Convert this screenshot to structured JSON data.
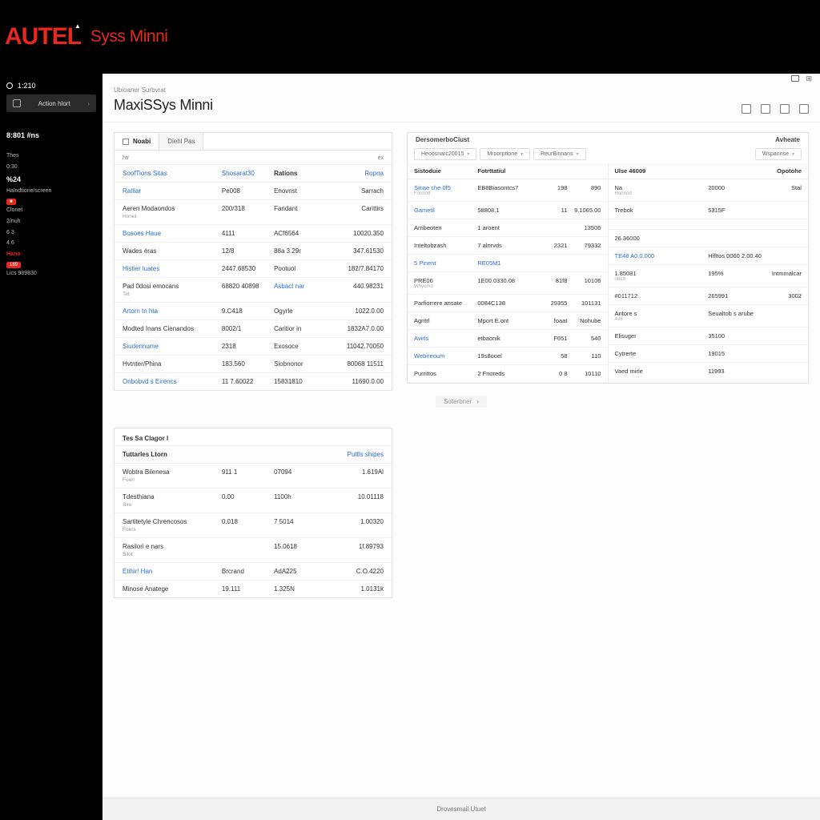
{
  "brand": {
    "logo": "AUTEL",
    "sub": "Syss Minni"
  },
  "sidebar": {
    "status": "1:210",
    "action_btn": "Action  hlort",
    "section": "8:801 #ns",
    "items": [
      {
        "label": "Thes",
        "cls": ""
      },
      {
        "label": "0:30",
        "cls": ""
      },
      {
        "label": "%24",
        "cls": "bright"
      },
      {
        "label": "Halndtione/screen",
        "cls": ""
      },
      {
        "label": "",
        "cls": "badge"
      },
      {
        "label": "Clonet",
        "cls": ""
      },
      {
        "label": "2/nuh",
        "cls": ""
      },
      {
        "label": "6 3",
        "cls": ""
      },
      {
        "label": "4.6",
        "cls": ""
      },
      {
        "label": "Hano",
        "cls": "accent"
      },
      {
        "label": "189",
        "cls": "badge"
      },
      {
        "label": "Lics  989830",
        "cls": ""
      }
    ]
  },
  "header": {
    "crumb": "Ubioaner  Surbvrat",
    "title": "MaxiSSys  Minni"
  },
  "panel1": {
    "tabs": [
      "Noabi",
      "Diehl Pas"
    ],
    "sub_left": "htr",
    "sub_right": "ex",
    "cols": [
      "SoofTions Sitas",
      "Shosarat30",
      "Rations",
      "Ropna"
    ],
    "rows": [
      {
        "a": "Ratiiar",
        "sub": "",
        "b": "Pe008",
        "c": "Enovnst",
        "d": "Sarrach"
      },
      {
        "a": "Aeren Modaondos",
        "sub": "Honet",
        "b": "200/318",
        "c": "Fandant",
        "d": "Carittirs"
      },
      {
        "a": "Bosoes Haue",
        "sub": "",
        "b": "4111",
        "c": "ACf6564",
        "d": "10020.350"
      },
      {
        "a": "Wades éras",
        "sub": "",
        "b": "12/8",
        "c": "88a 3.29r",
        "d": "347.61530"
      },
      {
        "a": "Histier luates",
        "sub": "",
        "b": "2447.68530",
        "c": "Pootuol",
        "d": "182/7.84170"
      },
      {
        "a": "Pad 0dosi emocans",
        "sub": "Tet",
        "b": "68820 40898",
        "c": "Asbact nar",
        "d": "440.98231"
      },
      {
        "a": "Artorn tn hta",
        "sub": "",
        "b": "9.C418",
        "c": "Ogyrle",
        "d": "1022.0.00"
      },
      {
        "a": "Modted Inans Cienandos",
        "sub": "",
        "b": "8002/1",
        "c": "Caritior in",
        "d": "1832A7.0.00"
      },
      {
        "a": "Siudennume",
        "sub": "",
        "b": "2318",
        "c": "Exosoce",
        "d": "11042.70050"
      },
      {
        "a": "Hvtnter/Phina",
        "sub": "",
        "b": "183.560",
        "c": "Siobnonor",
        "d": "80068 11511"
      },
      {
        "a": "Onbobvd s Eirencs",
        "sub": "",
        "b": "11 7.60022",
        "c": "15831810",
        "d": "11690.0.00"
      }
    ]
  },
  "pager": "Soterbner",
  "panel2": {
    "top_left": "DersomerboCiust",
    "top_right": "Avheate",
    "filters": [
      "Heoosnarc20015",
      "Mroorpttone",
      "ReurBinnans",
      "Wspannse"
    ],
    "left": {
      "head": [
        "Sistoduie",
        "Fotrttatiul",
        "",
        ""
      ],
      "rows": [
        {
          "a": "Sinae che 0f5",
          "sub": "Fonnod",
          "b": "EB8Biasontcs7",
          "c": "198",
          "d": "890"
        },
        {
          "a": "Gametil",
          "sub": "",
          "b": "58808.1",
          "c": "11",
          "d": "9.1065.00"
        },
        {
          "a": "Arribeoten",
          "sub": "",
          "b": "1 aroent",
          "c": "",
          "d": "13506"
        },
        {
          "a": "Inteltobzash",
          "sub": "",
          "b": "7 alnrvds",
          "c": "2321",
          "d": "79332"
        },
        {
          "a": "5 Pinent",
          "sub": "",
          "b": "RE05M1",
          "c": "",
          "d": ""
        },
        {
          "a": "PRE06",
          "sub": "Whyomd",
          "b": "1E00.0330.08",
          "c": "81f8",
          "d": "10106"
        },
        {
          "a": "Parfiorrere ansate",
          "sub": "",
          "b": "0084C138",
          "c": "29355",
          "d": "101131"
        },
        {
          "a": "Agritrl",
          "sub": "",
          "b": "Mport E.ont",
          "c": "foaat",
          "d": "Nohube"
        },
        {
          "a": "Avirls",
          "sub": "",
          "b": "etbaonik",
          "c": "F651",
          "d": "540"
        },
        {
          "a": "Webireoum",
          "sub": "",
          "b": "19s8ooel",
          "c": "58",
          "d": "110"
        },
        {
          "a": "Purrittos",
          "sub": "",
          "b": "2 Fnoreds",
          "c": "0 8",
          "d": "10110"
        }
      ]
    },
    "right": {
      "head": [
        "Ulse 46009",
        "Opotohe"
      ],
      "rows": [
        {
          "a": "Na",
          "sub": "Hormod",
          "b": "20000",
          "c": "Stal"
        },
        {
          "a": "Trebok",
          "sub": "",
          "b": "5315F",
          "c": ""
        },
        {
          "a": "",
          "sub": "",
          "b": "",
          "c": ""
        },
        {
          "a": "26.36000",
          "sub": "",
          "b": "",
          "c": ""
        },
        {
          "a": "TE48 A0.0.000",
          "sub": "",
          "b": "Hifltos 0060 2.00.40",
          "c": ""
        },
        {
          "a": "1.85081",
          "sub": "0819",
          "b": "195%",
          "c": "Intmmalcar"
        },
        {
          "a": "#011712",
          "sub": "",
          "b": "265991",
          "c": "3002"
        },
        {
          "a": "Antore s",
          "sub": "Aint",
          "b": "Seualtob s arube",
          "c": ""
        },
        {
          "a": "Elisuger",
          "sub": "",
          "b": "35100",
          "c": ""
        },
        {
          "a": "Cytrerte",
          "sub": "",
          "b": "19015",
          "c": ""
        },
        {
          "a": "Vaed mirle",
          "sub": "",
          "b": "11993",
          "c": ""
        }
      ]
    }
  },
  "panel3": {
    "title": "Tes Sa Clagor l",
    "cols": [
      "Tuttarles Ltorn",
      "",
      "",
      "Puttls shipes"
    ],
    "rows": [
      {
        "a": "Wobtra Bilenesa",
        "sub": "Foerl",
        "b": "911 1",
        "c": "07094",
        "d": "1.619Al"
      },
      {
        "a": "Tdesthiana",
        "sub": "Sire",
        "b": "0.00",
        "c": "1100h",
        "d": "10.01118"
      },
      {
        "a": "Sartitetyle Chrencosos",
        "sub": "Foers",
        "b": "0.018",
        "c": "7 5014",
        "d": "1.00320"
      },
      {
        "a": "Rasilori e nars",
        "sub": "Silot",
        "b": "",
        "c": "15.0618",
        "d": "1f.89793"
      },
      {
        "a": "Etihir! Han",
        "sub": "",
        "b": "Brcrand",
        "c": "AdA225",
        "d": "C.O.4220"
      },
      {
        "a": "Minose Anatege",
        "sub": "",
        "b": "19.111",
        "c": "1.325N",
        "d": "1.0131k"
      }
    ]
  },
  "footer": "Drovesmail Utuet"
}
